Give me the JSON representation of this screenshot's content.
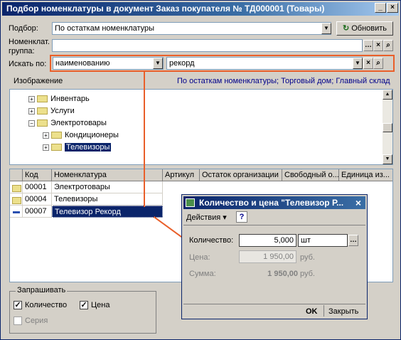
{
  "window": {
    "title": "Подбор номенклатуры в документ Заказ покупателя № ТД000001 (Товары)",
    "minimize": "_",
    "close": "×"
  },
  "selection": {
    "label": "Подбор:",
    "value": "По остаткам номенклатуры",
    "refresh_label": "Обновить"
  },
  "nomenclature_group": {
    "label_line1": "Номенклат.",
    "label_line2": "группа:",
    "value": ""
  },
  "search": {
    "label": "Искать по:",
    "by_value": "наименованию",
    "query_value": "рекорд"
  },
  "image_label": "Изображение",
  "context_link": "По остаткам номенклатуры; Торговый дом; Главный склад",
  "tree": [
    {
      "label": "Инвентарь",
      "selected": false
    },
    {
      "label": "Услуги",
      "selected": false
    },
    {
      "label": "Электротовары",
      "selected": false
    },
    {
      "label": "Кондиционеры",
      "selected": false
    },
    {
      "label": "Телевизоры",
      "selected": true
    }
  ],
  "table": {
    "columns": [
      "Код",
      "Номенклатура",
      "Артикул",
      "Остаток организации",
      "Свободный о...",
      "Единица из..."
    ],
    "rows": [
      {
        "code": "00001",
        "name": "Электротовары"
      },
      {
        "code": "00004",
        "name": "Телевизоры"
      },
      {
        "code": "00007",
        "name": "Телевизор Рекорд"
      }
    ]
  },
  "ask_group": {
    "title": "Запрашивать",
    "quantity_label": "Количество",
    "price_label": "Цена",
    "series_label": "Серия"
  },
  "dialog": {
    "title": "Количество и цена \"Телевизор Р...",
    "close": "×",
    "actions_label": "Действия",
    "help": "?",
    "quantity_label": "Количество:",
    "quantity_value": "5,000",
    "unit_value": "шт",
    "price_label": "Цена:",
    "price_value": "1 950,00",
    "price_currency": "руб.",
    "sum_label": "Сумма:",
    "sum_value": "1 950,00",
    "sum_currency": "руб.",
    "ok_label": "OK",
    "close_label": "Закрыть"
  },
  "colors": {
    "title_bar": "#0a246a",
    "highlight": "#e95f2a",
    "selection": "#0a246a"
  }
}
